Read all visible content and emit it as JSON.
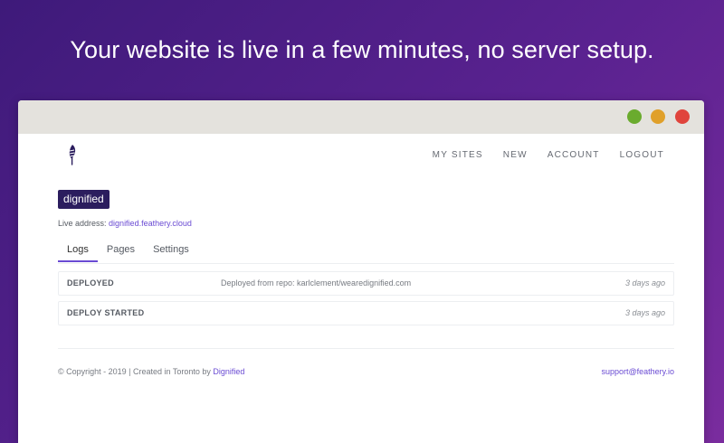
{
  "headline": "Your website is live in a few minutes, no server setup.",
  "colors": {
    "dot_green": "#6aab2e",
    "dot_yellow": "#e0a02a",
    "dot_red": "#e0443c",
    "accent": "#6a4bd3",
    "badge_bg": "#2b1d5e"
  },
  "nav": {
    "my_sites": "MY SITES",
    "new": "NEW",
    "account": "ACCOUNT",
    "logout": "LOGOUT"
  },
  "site": {
    "name": "dignified",
    "live_label": "Live address:",
    "live_url": "dignified.feathery.cloud"
  },
  "tabs": [
    {
      "label": "Logs",
      "active": true
    },
    {
      "label": "Pages",
      "active": false
    },
    {
      "label": "Settings",
      "active": false
    }
  ],
  "logs": [
    {
      "status": "DEPLOYED",
      "message": "Deployed from repo: karlclement/wearedignified.com",
      "time": "3 days ago"
    },
    {
      "status": "DEPLOY STARTED",
      "message": "",
      "time": "3 days ago"
    }
  ],
  "footer": {
    "copyright": "© Copyright - 2019 | Created in Toronto by",
    "creator": "Dignified",
    "support_email": "support@feathery.io"
  },
  "icons": {
    "logo": "feather-icon"
  }
}
